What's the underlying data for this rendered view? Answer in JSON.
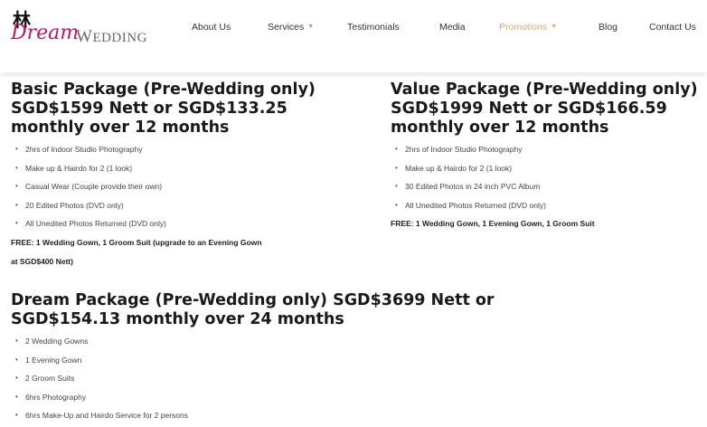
{
  "logo": {
    "mark": "林",
    "script": "Dream",
    "wedding_initial": "W",
    "wedding_rest": "EDDING"
  },
  "nav": {
    "items": [
      {
        "label": "About Us"
      },
      {
        "label": "Services",
        "has_dropdown": true
      },
      {
        "label": "Testimonials"
      },
      {
        "label": "Media"
      },
      {
        "label": "Promotions",
        "has_dropdown": true,
        "active": true
      },
      {
        "label": "Blog"
      },
      {
        "label": "Contact Us"
      }
    ]
  },
  "packages": [
    {
      "title": "Basic Package (Pre-Wedding only) SGD$1599 Nett or SGD$133.25 monthly over 12 months",
      "items": [
        "2hrs of Indoor Studio Photography",
        "Make up & Hairdo for 2 (1 look)",
        "Casual Wear (Couple provide their own)",
        "20 Edited Photos (DVD only)",
        "All Unedited Photos Returned (DVD only)"
      ],
      "free_line1": "FREE: 1 Wedding Gown, 1 Groom Suit (upgrade to an Evening Gown",
      "free_line2": "at SGD$400 Nett)"
    },
    {
      "title": "Value Package (Pre-Wedding only) SGD$1999 Nett or SGD$166.59 monthly over 12 months",
      "items": [
        "2hrs of Indoor Studio Photography",
        "Make up & Hairdo for 2 (1 look)",
        "30 Edited Photos in 24 inch PVC Album",
        "All Unedited Photos Returned (DVD only)"
      ],
      "free_line1": "FREE: 1 Wedding Gown, 1 Evening Gown, 1 Groom Suit"
    },
    {
      "title": "Dream Package (Pre-Wedding only) SGD$3699 Nett or SGD$154.13 monthly over 24 months",
      "items": [
        "2 Wedding Gowns",
        "1 Evening Gown",
        "2 Groom Suits",
        "6hrs Photography",
        "6hrs Make-Up and Hairdo Service for 2 persons"
      ]
    }
  ],
  "colors": {
    "accent": "#d9a868",
    "brand": "#c2185b"
  }
}
